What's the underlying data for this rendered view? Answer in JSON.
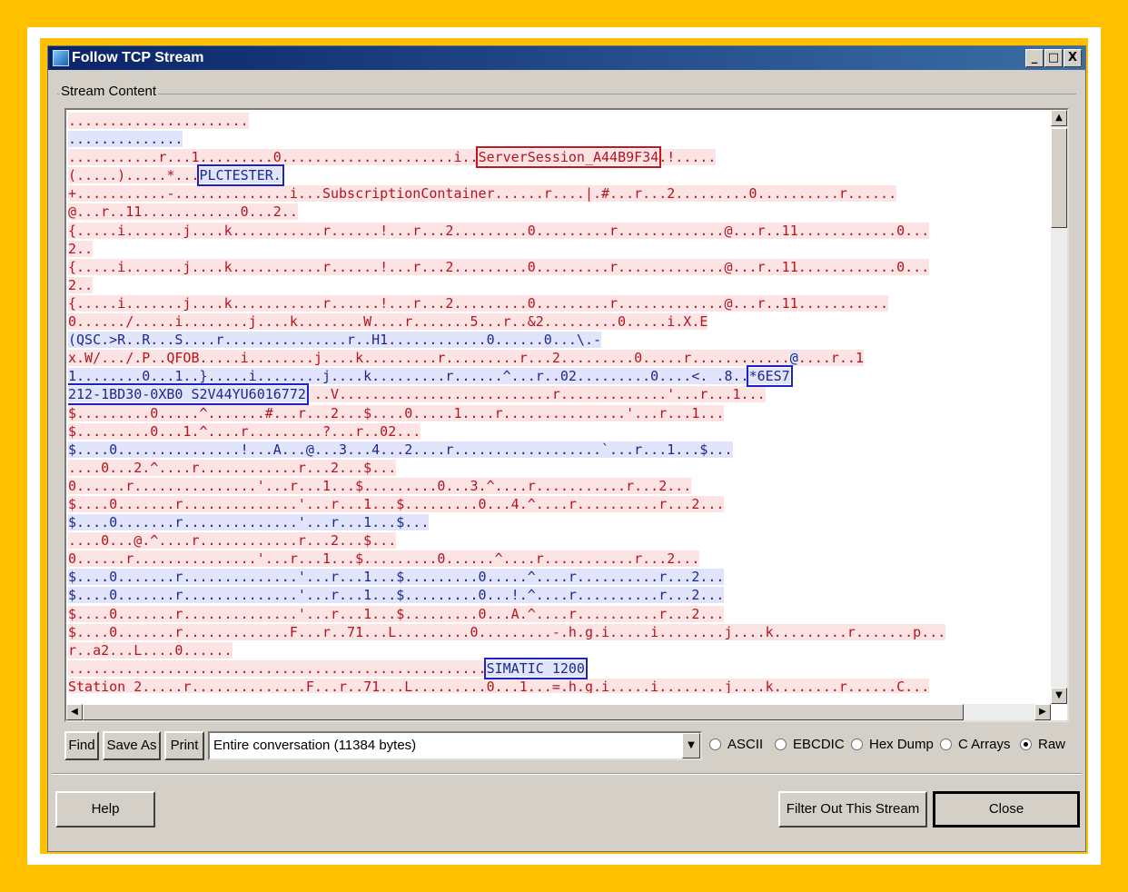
{
  "window": {
    "title": "Follow TCP Stream",
    "min": "_",
    "max": "□",
    "close": "X"
  },
  "group_label": "Stream Content",
  "stream_lines": [
    [
      {
        "t": "......................",
        "c": "c"
      }
    ],
    [
      {
        "t": "..............",
        "c": "s"
      }
    ],
    [
      {
        "t": "...........r...1.........",
        "c": "c"
      },
      {
        "t": "0.....................i..",
        "c": "c"
      },
      {
        "t": "ServerSession_A44B9F34",
        "c": "c",
        "hl": "red"
      },
      {
        "t": ".!.....",
        "c": "c"
      }
    ],
    [
      {
        "t": "(.....).....*...",
        "c": "c"
      },
      {
        "t": "PLCTESTER.",
        "c": "s",
        "hl": "blue"
      }
    ],
    [
      {
        "t": "+...........-..............i...SubscriptionContainer......r....|.#...r...2.........0..........r......",
        "c": "c"
      }
    ],
    [
      {
        "t": "@...r..11............0...2..",
        "c": "c"
      }
    ],
    [
      {
        "t": "{.....i.......j....k...........r......!...r...2.........0.........r.............@...r..11............0...",
        "c": "c"
      }
    ],
    [
      {
        "t": "2..",
        "c": "c"
      }
    ],
    [
      {
        "t": "{.....i.......j....k...........r......!...r...2.........0.........r.............@...r..11............0...",
        "c": "c"
      }
    ],
    [
      {
        "t": "2..",
        "c": "c"
      }
    ],
    [
      {
        "t": "{.....i.......j....k...........r......!...r...2.........0.........r.............@...r..11...........",
        "c": "c"
      }
    ],
    [
      {
        "t": "0....../.....i........j....k........W....r.......5...r..&2.........0.....i.X.E",
        "c": "c"
      }
    ],
    [
      {
        "t": "(QSC.>R..R...S....r...............r..H1............0......0...\\.-",
        "c": "s"
      }
    ],
    [
      {
        "t": "x.W/.../.P..QFOB.....i........j....k.........r.........r...2.........0.....r............",
        "c": "c"
      },
      {
        "t": "@",
        "c": "s"
      },
      {
        "t": "....r..1",
        "c": "c"
      }
    ],
    [
      {
        "t": "1........0...1..}.....i........j....k.........r......^...r..02.........0....<. .8..",
        "c": "s"
      },
      {
        "t": "*6ES7",
        "c": "s",
        "hl": "blue"
      }
    ],
    [
      {
        "t": "212-1BD30-0XB0 S2V44YU6016772",
        "c": "s",
        "hl": "blue"
      },
      {
        "t": " ..V..........................r.............'...r...1...",
        "c": "c"
      }
    ],
    [
      {
        "t": "$.........0.....^.......#...r...2...$....0.....1....r...............'...r...1...",
        "c": "c"
      }
    ],
    [
      {
        "t": "$.........0...1.^....r.........?...r..02...",
        "c": "c"
      }
    ],
    [
      {
        "t": "$....0...............!...A...@...3...4...2....r..................`...r...1...$...",
        "c": "s"
      }
    ],
    [
      {
        "t": "....0...2.^....r............r...2...$...",
        "c": "c"
      }
    ],
    [
      {
        "t": "0......r...............'...r...1...$.........0...3.^....r...........r...2...",
        "c": "c"
      }
    ],
    [
      {
        "t": "$....0.......r..............'...r...1...$.........0...4.^....r..........r...2...",
        "c": "c"
      }
    ],
    [
      {
        "t": "$....0.......r..............'...r...1...$...",
        "c": "s"
      }
    ],
    [
      {
        "t": "....0...@.^....r............r...2...$...",
        "c": "c"
      }
    ],
    [
      {
        "t": "0......r...............'...r...1...$.........0......^....r...........r...2...",
        "c": "c"
      }
    ],
    [
      {
        "t": "$....0.......r..............'...r...1...$.........0.....^....r..........r...2...",
        "c": "s"
      }
    ],
    [
      {
        "t": "$....0.......r..............'...r...1...$.........0...!.^....r..........r...2...",
        "c": "s"
      }
    ],
    [
      {
        "t": "$....0.......r..............'...r...1...$.........0...A.^....r..........r...2...",
        "c": "c"
      }
    ],
    [
      {
        "t": "$....0.......r.............F...r..71...L.........0.........-.h.g.i.....i........j....k.........r.......p...",
        "c": "c"
      }
    ],
    [
      {
        "t": "r..a2...L....0......",
        "c": "c"
      }
    ],
    [
      {
        "t": "...................................................",
        "c": "c"
      },
      {
        "t": "SIMATIC 1200",
        "c": "s",
        "hl": "blue"
      }
    ],
    [
      {
        "t": "Station_2.....r..............F...r..71...L.........0...1...=.h.g.i.....i........j....k........r......C...",
        "c": "c"
      }
    ]
  ],
  "controls": {
    "find": "Find",
    "save_as": "Save As",
    "print": "Print",
    "conversation": "Entire conversation (11384 bytes)",
    "formats": [
      "ASCII",
      "EBCDIC",
      "Hex Dump",
      "C Arrays",
      "Raw"
    ],
    "selected_format": "Raw"
  },
  "bottom": {
    "help": "Help",
    "filter": "Filter Out This Stream",
    "close": "Close"
  },
  "colors": {
    "client": "#b4141e",
    "server": "#1c2a8c",
    "highlight_red": "#c8141e",
    "highlight_blue": "#1a24c8",
    "frame": "#ffc000"
  }
}
